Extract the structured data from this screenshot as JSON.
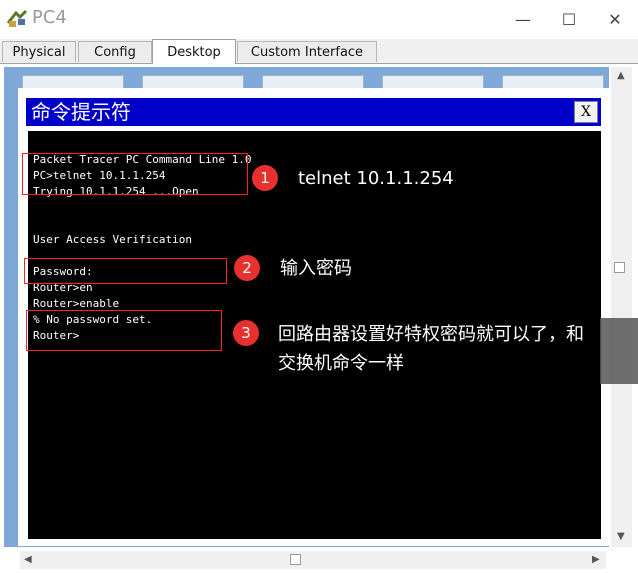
{
  "window": {
    "title": "PC4",
    "minimize_glyph": "—",
    "maximize_glyph": "☐",
    "close_glyph": "✕",
    "icon": "packet-tracer-icon"
  },
  "tabs": [
    {
      "label": "Physical",
      "active": false
    },
    {
      "label": "Config",
      "active": false
    },
    {
      "label": "Desktop",
      "active": true
    },
    {
      "label": "Custom Interface",
      "active": false
    }
  ],
  "cmd_window": {
    "title": "命令提示符",
    "close_label": "X"
  },
  "console_lines": [
    "Packet Tracer PC Command Line 1.0",
    "PC>telnet 10.1.1.254",
    "Trying 10.1.1.254 ...Open",
    "",
    "",
    "User Access Verification",
    "",
    "Password:",
    "Router>en",
    "Router>enable",
    "% No password set.",
    "Router>"
  ],
  "annotations": [
    {
      "number": "1",
      "text": "telnet 10.1.1.254"
    },
    {
      "number": "2",
      "text": "输入密码"
    },
    {
      "number": "3",
      "text_line1": "回路由器设置好特权密码就可以了，和",
      "text_line2": "交换机命令一样"
    }
  ],
  "colors": {
    "cmd_title_bg": "#0000c8",
    "console_bg": "#000000",
    "annotation_red": "#e8312f",
    "desktop_bg": "#7ea8d8"
  }
}
